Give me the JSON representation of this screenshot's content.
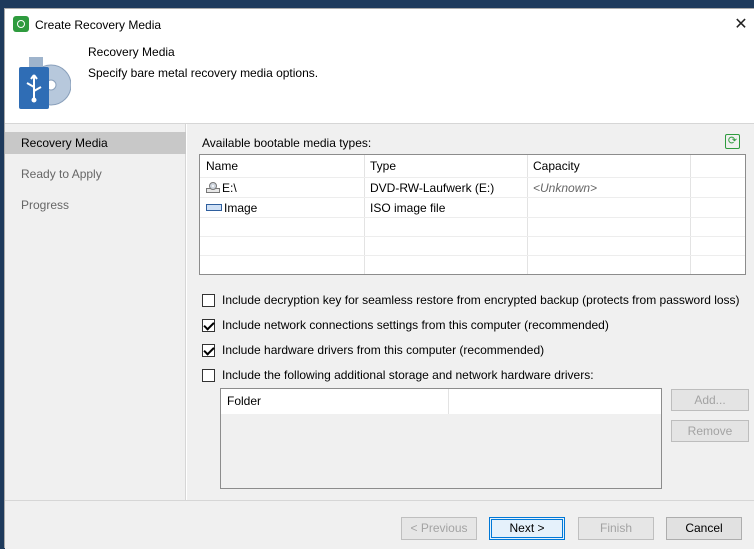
{
  "window": {
    "title": "Create Recovery Media",
    "close_glyph": "✕"
  },
  "header": {
    "title": "Recovery Media",
    "subtitle": "Specify bare metal recovery media options.",
    "icon": "usb-disc-icon"
  },
  "sidebar": {
    "items": [
      {
        "label": "Recovery Media",
        "active": true
      },
      {
        "label": "Ready to Apply",
        "active": false
      },
      {
        "label": "Progress",
        "active": false
      }
    ]
  },
  "media": {
    "label": "Available bootable media types:",
    "columns": [
      "Name",
      "Type",
      "Capacity"
    ],
    "rows": [
      {
        "name": "E:\\",
        "type": "DVD-RW-Laufwerk (E:)",
        "capacity": "<Unknown>",
        "icon": "dvd-drive-icon"
      },
      {
        "name": "Image",
        "type": "ISO image file",
        "capacity": "",
        "icon": "iso-image-icon"
      }
    ]
  },
  "options": [
    {
      "label": "Include decryption key for seamless restore from encrypted backup (protects from password loss)",
      "checked": false
    },
    {
      "label": "Include network connections settings from this computer (recommended)",
      "checked": true
    },
    {
      "label": "Include hardware drivers from this computer (recommended)",
      "checked": true
    },
    {
      "label": "Include the following additional storage and network hardware drivers:",
      "checked": false
    }
  ],
  "drivers": {
    "column": "Folder",
    "add_label": "Add...",
    "remove_label": "Remove"
  },
  "footer": {
    "previous": "< Previous",
    "next": "Next >",
    "finish": "Finish",
    "cancel": "Cancel"
  },
  "colors": {
    "accent": "#0078d7",
    "brand": "#2e9b3e",
    "sidebar_active": "#c8c8c8"
  }
}
